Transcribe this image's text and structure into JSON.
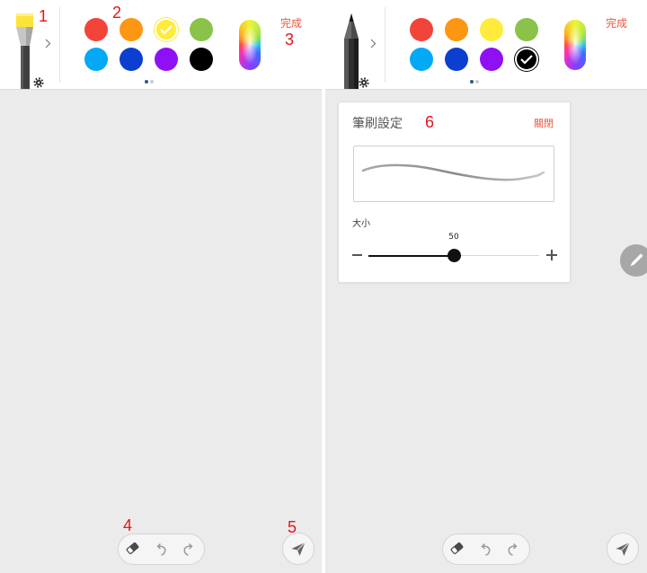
{
  "colors": {
    "accent": "#e8573f",
    "annotation": "#e8131a",
    "canvas": "#ebebeb"
  },
  "annotations": {
    "a1": "1",
    "a2": "2",
    "a3": "3",
    "a4": "4",
    "a5": "5",
    "a6": "6"
  },
  "screens": [
    {
      "toolbar": {
        "tool_icon": "highlighter-icon",
        "settings_icon": "gear-icon",
        "expand_icon": "chevron-right-icon",
        "palette": [
          "#f2443a",
          "#fd9612",
          "#ffeb3b",
          "#8bc34a",
          "#03a9f4",
          "#0c3fd0",
          "#9010f5",
          "#000000"
        ],
        "selected_color": "#ffeb3b",
        "selected_icon": "checkmark-icon",
        "palette_page": 1,
        "palette_page_count": 2,
        "custom_color_icon": "color-spectrum-icon",
        "done_label": "完成"
      },
      "bottom_bar": {
        "eraser_icon": "eraser-icon",
        "undo_icon": "undo-icon",
        "redo_icon": "redo-icon",
        "send_icon": "send-icon"
      }
    },
    {
      "toolbar": {
        "tool_icon": "pencil-icon",
        "settings_icon": "gear-icon",
        "expand_icon": "chevron-right-icon",
        "palette": [
          "#f2443a",
          "#fd9612",
          "#ffeb3b",
          "#8bc34a",
          "#03a9f4",
          "#0c3fd0",
          "#9010f5",
          "#000000"
        ],
        "selected_color": "#000000",
        "selected_icon": "checkmark-icon",
        "palette_page": 1,
        "palette_page_count": 2,
        "custom_color_icon": "color-spectrum-icon",
        "done_label": "完成"
      },
      "brush_settings": {
        "title": "筆刷設定",
        "close_label": "關閉",
        "size_label": "大小",
        "size_value": "50",
        "size_level": 0.5,
        "decrease_icon": "minus-icon",
        "increase_icon": "plus-icon"
      },
      "floating_button_icon": "pencil-icon",
      "bottom_bar": {
        "eraser_icon": "eraser-icon",
        "undo_icon": "undo-icon",
        "redo_icon": "redo-icon",
        "send_icon": "send-icon"
      }
    }
  ]
}
